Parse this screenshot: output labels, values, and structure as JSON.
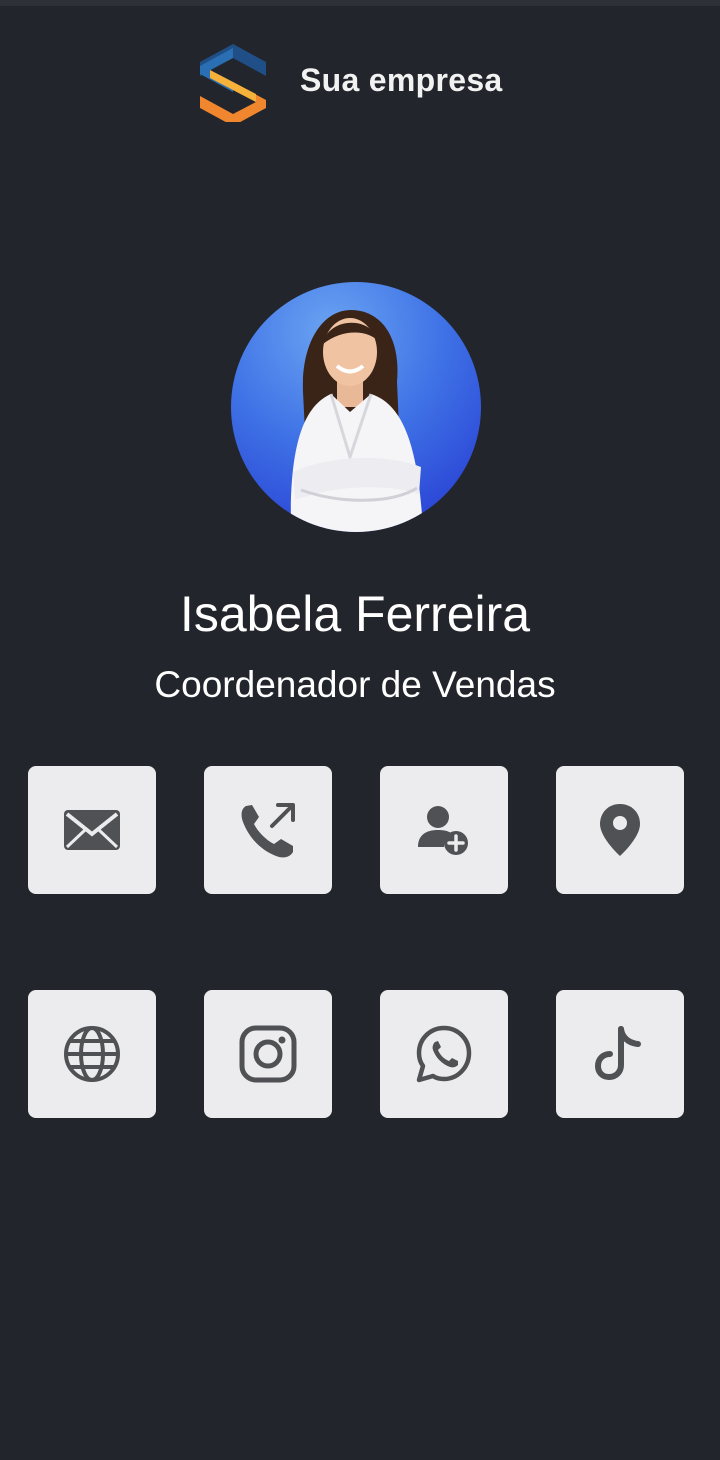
{
  "brand": {
    "name": "Sua empresa",
    "logo_icon": "hexagon-s-logo",
    "logo_colors": {
      "blue": "#1f4f86",
      "orange": "#f0862d",
      "yellow": "#f6b13a"
    }
  },
  "profile": {
    "name": "Isabela Ferreira",
    "role": "Coordenador de Vendas",
    "avatar_icon": "profile-photo",
    "avatar_background": "#3f72e6"
  },
  "actions": [
    {
      "icon": "email-icon"
    },
    {
      "icon": "phone-call-icon"
    },
    {
      "icon": "add-contact-icon"
    },
    {
      "icon": "location-pin-icon"
    },
    {
      "icon": "globe-icon"
    },
    {
      "icon": "instagram-icon"
    },
    {
      "icon": "whatsapp-icon"
    },
    {
      "icon": "tiktok-icon"
    }
  ],
  "colors": {
    "background": "#22252b",
    "tile": "#ececef",
    "icon": "#505154",
    "text": "#ffffff"
  }
}
